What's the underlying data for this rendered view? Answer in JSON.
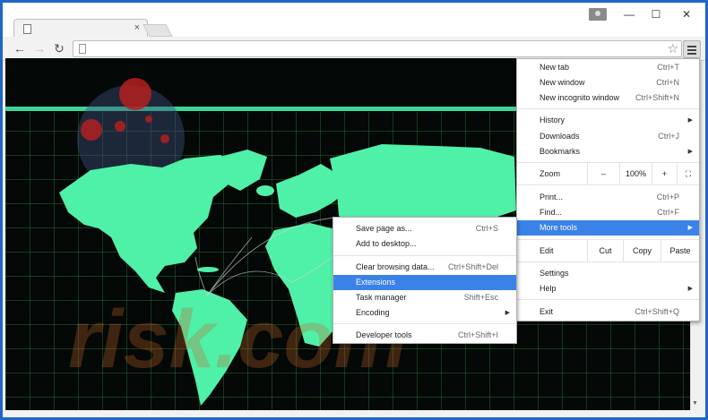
{
  "window": {
    "tab_close": "×",
    "minimize": "—",
    "maximize": "☐",
    "close": "✕"
  },
  "toolbar": {
    "back": "←",
    "forward": "→",
    "reload": "↻",
    "star": "☆"
  },
  "watermark": {
    "text": "risk.com"
  },
  "main_menu": {
    "items": [
      {
        "label": "New tab",
        "shortcut": "Ctrl+T"
      },
      {
        "label": "New window",
        "shortcut": "Ctrl+N"
      },
      {
        "label": "New incognito window",
        "shortcut": "Ctrl+Shift+N"
      },
      {
        "label": "History",
        "submenu": true
      },
      {
        "label": "Downloads",
        "shortcut": "Ctrl+J"
      },
      {
        "label": "Bookmarks",
        "submenu": true
      },
      {
        "label": "Print...",
        "shortcut": "Ctrl+P"
      },
      {
        "label": "Find...",
        "shortcut": "Ctrl+F"
      },
      {
        "label": "More tools",
        "submenu": true,
        "active": true
      },
      {
        "label": "Settings"
      },
      {
        "label": "Help",
        "submenu": true
      },
      {
        "label": "Exit",
        "shortcut": "Ctrl+Shift+Q"
      }
    ],
    "zoom": {
      "label": "Zoom",
      "minus": "–",
      "value": "100%",
      "plus": "+",
      "fullscreen": "⛶"
    },
    "edit": {
      "label": "Edit",
      "cut": "Cut",
      "copy": "Copy",
      "paste": "Paste"
    }
  },
  "sub_menu": {
    "items": [
      {
        "label": "Save page as...",
        "shortcut": "Ctrl+S"
      },
      {
        "label": "Add to desktop..."
      },
      {
        "label": "Clear browsing data...",
        "shortcut": "Ctrl+Shift+Del"
      },
      {
        "label": "Extensions",
        "active": true
      },
      {
        "label": "Task manager",
        "shortcut": "Shift+Esc"
      },
      {
        "label": "Encoding",
        "submenu": true
      },
      {
        "label": "Developer tools",
        "shortcut": "Ctrl+Shift+I"
      }
    ]
  },
  "colors": {
    "frame": "#1f66c8",
    "map_land": "#4ff0a8",
    "grid": "#1f5a2c",
    "highlight": "#3b82e8"
  },
  "icons": {
    "menu": "hamburger-icon",
    "page": "page-icon",
    "user": "user-icon"
  }
}
